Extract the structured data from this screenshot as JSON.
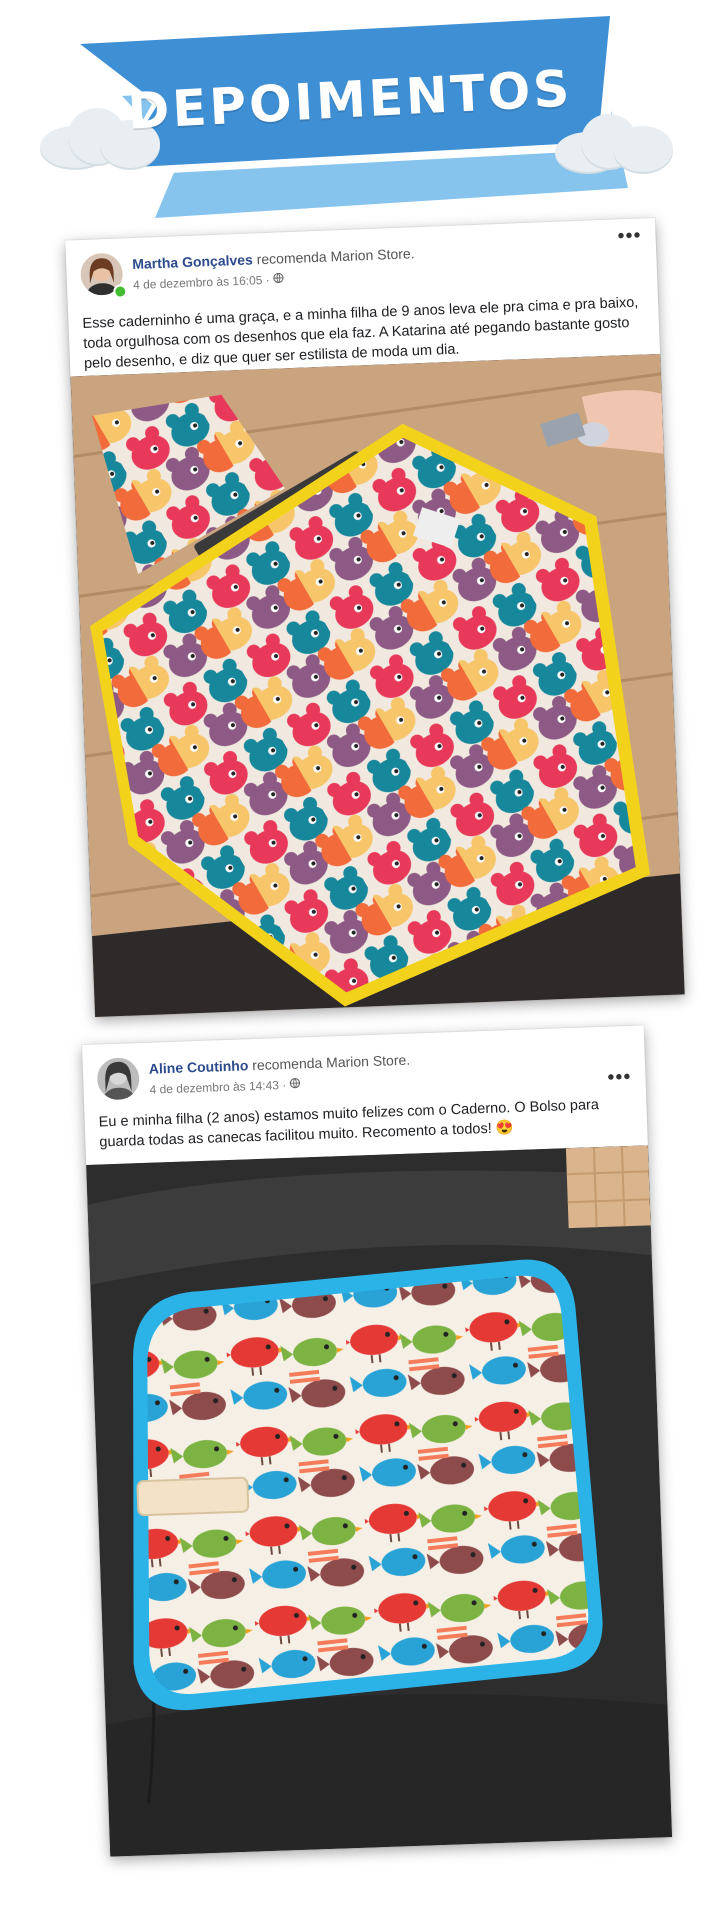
{
  "banner": {
    "title": "DEPOIMENTOS",
    "colors": {
      "main": "#3f8fd4",
      "light": "#86c4ee",
      "cloud": "#e8eef2"
    }
  },
  "posts": [
    {
      "author": "Martha Gonçalves",
      "action": "recomenda Marion Store.",
      "date": "4 de dezembro às 16:05",
      "separator": "·",
      "privacy_icon": "globe-icon",
      "more_label": "•••",
      "text": "Esse caderninho é uma graça, e a minha filha de 9 anos leva ele pra cima e pra baixo, toda orgulhosa com os desenhos que ela faz. A Katarina até pegando bastante gosto pelo desenho, e diz que quer ser estilista de moda um dia.",
      "photo": "bear-pattern-notebook-with-crayons"
    },
    {
      "author": "Aline Coutinho",
      "action": "recomenda Marion Store.",
      "date": "4 de dezembro às 14:43",
      "separator": "·",
      "privacy_icon": "globe-icon",
      "more_label": "•••",
      "text": "Eu e minha filha (2 anos) estamos muito felizes com o Caderno. O Bolso para guarda todas as canecas facilitou muito. Recomento a todos! 😍",
      "photo": "bird-pattern-notebook"
    }
  ]
}
